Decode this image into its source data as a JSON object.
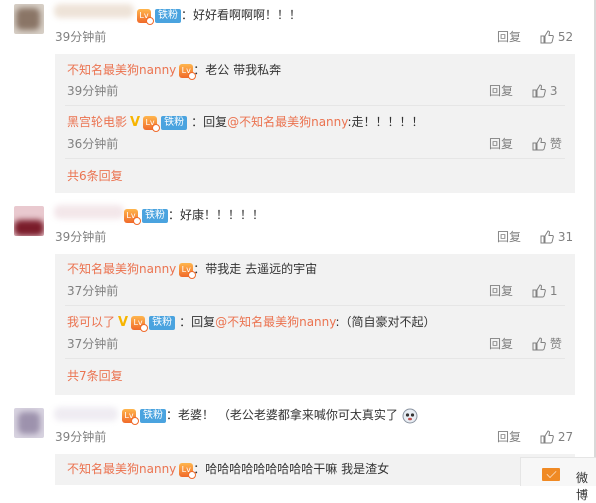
{
  "comments": [
    {
      "text": "：好好看啊啊啊！！！",
      "time": "39分钟前",
      "reply": "回复",
      "likes": "52",
      "subs": [
        {
          "user": "不知名最美狗nanny",
          "prefix": "：",
          "text": "老公 带我私奔",
          "time": "39分钟前",
          "reply": "回复",
          "likes": "3"
        },
        {
          "user": "黑宫轮电影",
          "prefix": "：回复",
          "mention": "@不知名最美狗nanny",
          "text": ":走！！！！！",
          "time": "36分钟前",
          "reply": "回复",
          "likes": "赞"
        }
      ],
      "more": "共6条回复"
    },
    {
      "text": "：好康！！！！！",
      "time": "39分钟前",
      "reply": "回复",
      "likes": "31",
      "subs": [
        {
          "user": "不知名最美狗nanny",
          "prefix": "：",
          "text": "带我走 去遥远的宇宙",
          "time": "37分钟前",
          "reply": "回复",
          "likes": "1"
        },
        {
          "user": "我可以了",
          "prefix": "：回复",
          "mention": "@不知名最美狗nanny",
          "text": ":（简自豪对不起）",
          "time": "37分钟前",
          "reply": "回复",
          "likes": "赞"
        }
      ],
      "more": "共7条回复"
    },
    {
      "text": "：老婆！ （老公老婆都拿来喊你可太真实了",
      "time": "39分钟前",
      "reply": "回复",
      "likes": "27",
      "subs": [
        {
          "user": "不知名最美狗nanny",
          "prefix": "：",
          "text": "哈哈哈哈哈哈哈哈哈干嘛 我是渣女"
        }
      ]
    }
  ],
  "badge": {
    "fan": "铁粉",
    "level": "Lv"
  },
  "footer": {
    "label": "微博"
  },
  "colors": {
    "link": "#eb7350",
    "muted": "#808080",
    "fan_badge": "#4aa3df",
    "sub_bg": "#f2f2f2"
  },
  "icons": [
    "thumbs-up-icon",
    "level-badge-icon",
    "verified-v-icon",
    "mail-icon",
    "emoji-face-icon"
  ]
}
